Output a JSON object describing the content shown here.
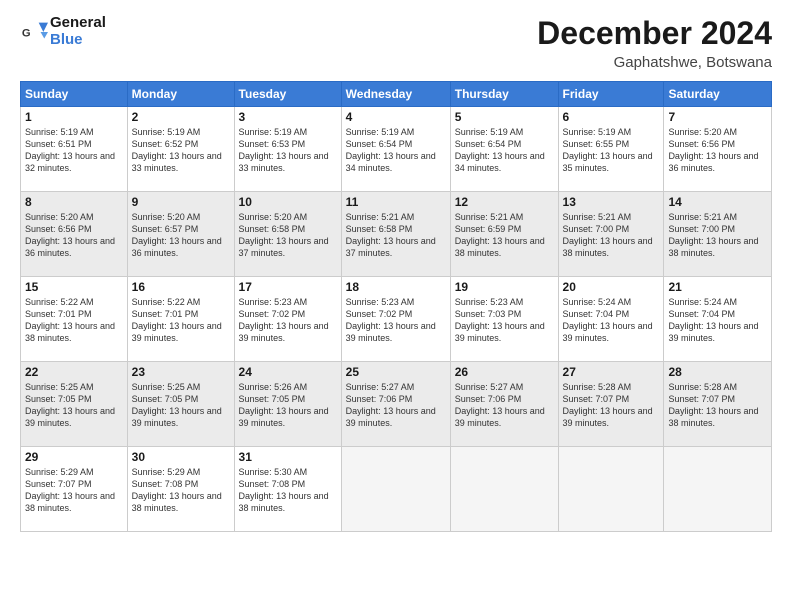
{
  "logo": {
    "line1": "General",
    "line2": "Blue"
  },
  "title": "December 2024",
  "subtitle": "Gaphatshwe, Botswana",
  "weekdays": [
    "Sunday",
    "Monday",
    "Tuesday",
    "Wednesday",
    "Thursday",
    "Friday",
    "Saturday"
  ],
  "weeks": [
    [
      {
        "day": "1",
        "sunrise": "5:19 AM",
        "sunset": "6:51 PM",
        "daylight": "13 hours and 32 minutes."
      },
      {
        "day": "2",
        "sunrise": "5:19 AM",
        "sunset": "6:52 PM",
        "daylight": "13 hours and 33 minutes."
      },
      {
        "day": "3",
        "sunrise": "5:19 AM",
        "sunset": "6:53 PM",
        "daylight": "13 hours and 33 minutes."
      },
      {
        "day": "4",
        "sunrise": "5:19 AM",
        "sunset": "6:54 PM",
        "daylight": "13 hours and 34 minutes."
      },
      {
        "day": "5",
        "sunrise": "5:19 AM",
        "sunset": "6:54 PM",
        "daylight": "13 hours and 34 minutes."
      },
      {
        "day": "6",
        "sunrise": "5:19 AM",
        "sunset": "6:55 PM",
        "daylight": "13 hours and 35 minutes."
      },
      {
        "day": "7",
        "sunrise": "5:20 AM",
        "sunset": "6:56 PM",
        "daylight": "13 hours and 36 minutes."
      }
    ],
    [
      {
        "day": "8",
        "sunrise": "5:20 AM",
        "sunset": "6:56 PM",
        "daylight": "13 hours and 36 minutes."
      },
      {
        "day": "9",
        "sunrise": "5:20 AM",
        "sunset": "6:57 PM",
        "daylight": "13 hours and 36 minutes."
      },
      {
        "day": "10",
        "sunrise": "5:20 AM",
        "sunset": "6:58 PM",
        "daylight": "13 hours and 37 minutes."
      },
      {
        "day": "11",
        "sunrise": "5:21 AM",
        "sunset": "6:58 PM",
        "daylight": "13 hours and 37 minutes."
      },
      {
        "day": "12",
        "sunrise": "5:21 AM",
        "sunset": "6:59 PM",
        "daylight": "13 hours and 38 minutes."
      },
      {
        "day": "13",
        "sunrise": "5:21 AM",
        "sunset": "7:00 PM",
        "daylight": "13 hours and 38 minutes."
      },
      {
        "day": "14",
        "sunrise": "5:21 AM",
        "sunset": "7:00 PM",
        "daylight": "13 hours and 38 minutes."
      }
    ],
    [
      {
        "day": "15",
        "sunrise": "5:22 AM",
        "sunset": "7:01 PM",
        "daylight": "13 hours and 38 minutes."
      },
      {
        "day": "16",
        "sunrise": "5:22 AM",
        "sunset": "7:01 PM",
        "daylight": "13 hours and 39 minutes."
      },
      {
        "day": "17",
        "sunrise": "5:23 AM",
        "sunset": "7:02 PM",
        "daylight": "13 hours and 39 minutes."
      },
      {
        "day": "18",
        "sunrise": "5:23 AM",
        "sunset": "7:02 PM",
        "daylight": "13 hours and 39 minutes."
      },
      {
        "day": "19",
        "sunrise": "5:23 AM",
        "sunset": "7:03 PM",
        "daylight": "13 hours and 39 minutes."
      },
      {
        "day": "20",
        "sunrise": "5:24 AM",
        "sunset": "7:04 PM",
        "daylight": "13 hours and 39 minutes."
      },
      {
        "day": "21",
        "sunrise": "5:24 AM",
        "sunset": "7:04 PM",
        "daylight": "13 hours and 39 minutes."
      }
    ],
    [
      {
        "day": "22",
        "sunrise": "5:25 AM",
        "sunset": "7:05 PM",
        "daylight": "13 hours and 39 minutes."
      },
      {
        "day": "23",
        "sunrise": "5:25 AM",
        "sunset": "7:05 PM",
        "daylight": "13 hours and 39 minutes."
      },
      {
        "day": "24",
        "sunrise": "5:26 AM",
        "sunset": "7:05 PM",
        "daylight": "13 hours and 39 minutes."
      },
      {
        "day": "25",
        "sunrise": "5:27 AM",
        "sunset": "7:06 PM",
        "daylight": "13 hours and 39 minutes."
      },
      {
        "day": "26",
        "sunrise": "5:27 AM",
        "sunset": "7:06 PM",
        "daylight": "13 hours and 39 minutes."
      },
      {
        "day": "27",
        "sunrise": "5:28 AM",
        "sunset": "7:07 PM",
        "daylight": "13 hours and 39 minutes."
      },
      {
        "day": "28",
        "sunrise": "5:28 AM",
        "sunset": "7:07 PM",
        "daylight": "13 hours and 38 minutes."
      }
    ],
    [
      {
        "day": "29",
        "sunrise": "5:29 AM",
        "sunset": "7:07 PM",
        "daylight": "13 hours and 38 minutes."
      },
      {
        "day": "30",
        "sunrise": "5:29 AM",
        "sunset": "7:08 PM",
        "daylight": "13 hours and 38 minutes."
      },
      {
        "day": "31",
        "sunrise": "5:30 AM",
        "sunset": "7:08 PM",
        "daylight": "13 hours and 38 minutes."
      },
      null,
      null,
      null,
      null
    ]
  ]
}
